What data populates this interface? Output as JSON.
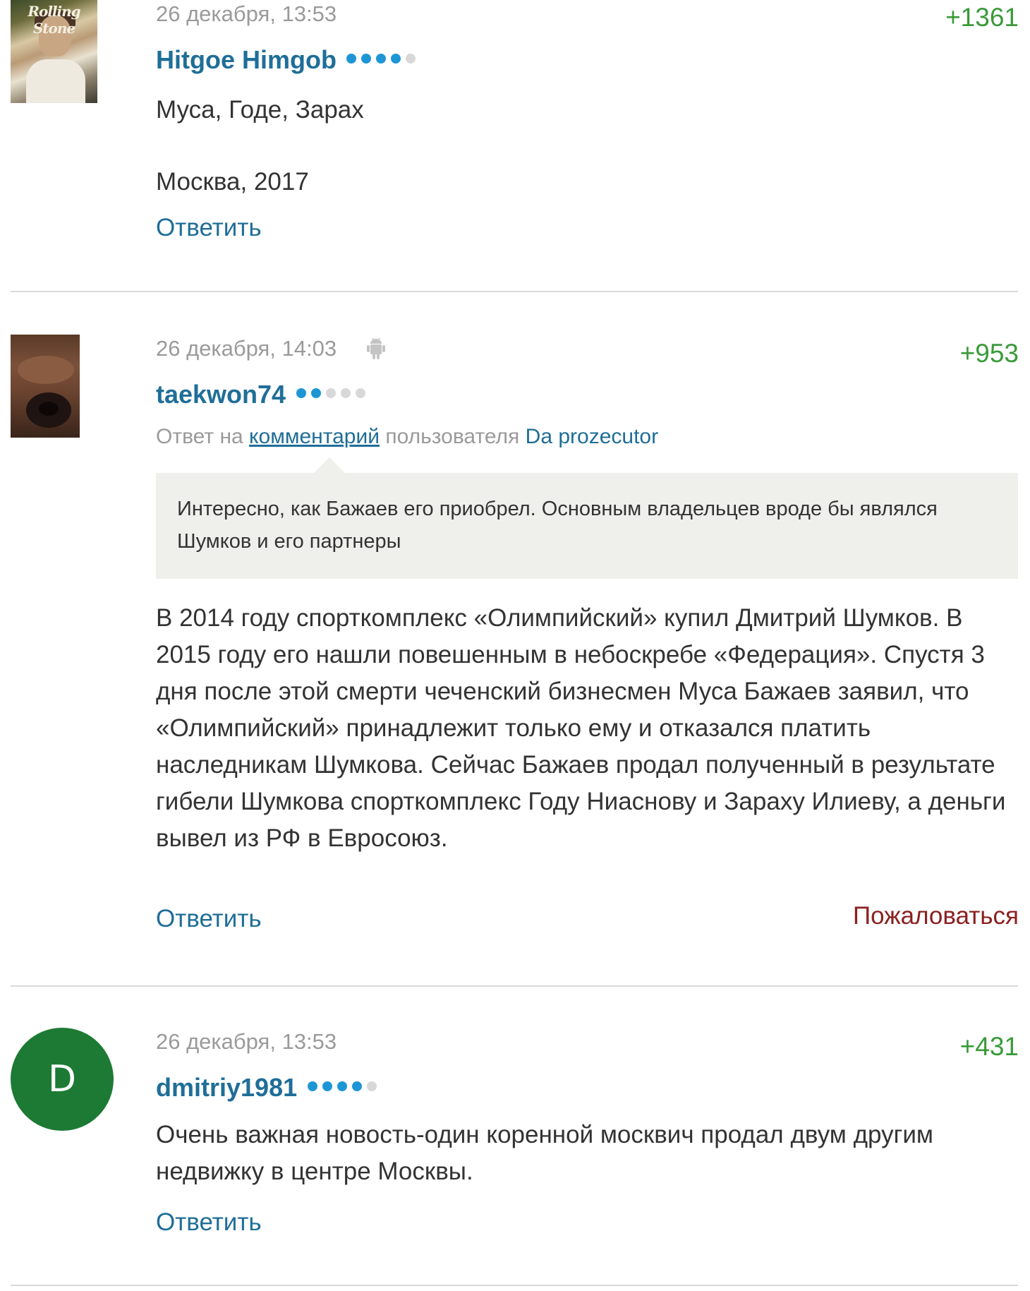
{
  "comments": [
    {
      "date": "26 декабря, 13:53",
      "score": "+1361",
      "username": "Hitgoe Himgob",
      "rating_filled": 4,
      "rating_total": 5,
      "text_line1": "Муса, Годе, Зарах",
      "text_line2": "Москва, 2017",
      "reply_label": "Ответить",
      "avatar_text": "Rolling Stone"
    },
    {
      "date": "26 декабря, 14:03",
      "device_icon": "android-icon",
      "score": "+953",
      "username": "taekwon74",
      "rating_filled": 2,
      "rating_total": 5,
      "reply_to_prefix": "Ответ на",
      "reply_to_link": "комментарий",
      "reply_to_middle": "пользователя",
      "reply_to_user": "Da prozecutor",
      "quote": "Интересно, как Бажаев его приобрел. Основным владельцев вроде бы являлся Шумков и его партнеры",
      "text": "В 2014 году спорткомплекс «Олимпийский» купил Дмитрий Шумков. В 2015 году его нашли повешенным в небоскребе «Федерация». Спустя 3 дня после этой смерти чеченский бизнесмен Муса Бажаев заявил, что «Олимпийский» принадлежит только ему и отказался платить наследникам Шумкова. Сейчас Бажаев продал полученный в результате гибели Шумкова спорткомплекс Году Ниаснову и Зараху Илиеву, а деньги вывел из РФ в Евросоюз.",
      "reply_label": "Ответить",
      "complain_label": "Пожаловаться"
    },
    {
      "date": "26 декабря, 13:53",
      "score": "+431",
      "username": "dmitriy1981",
      "avatar_letter": "D",
      "avatar_color": "#1d7a34",
      "rating_filled": 4,
      "rating_total": 5,
      "text": "Очень важная новость-один коренной москвич продал двум другим недвижку в центре Москвы.",
      "reply_label": "Ответить"
    }
  ],
  "colors": {
    "username": "#1f6e98",
    "score": "#3a9a3a",
    "date": "#9a9a9a",
    "complain": "#8b2020",
    "rating_on": "#1e96d6",
    "rating_off": "#d8d8d8",
    "quote_bg": "#efefeb"
  }
}
